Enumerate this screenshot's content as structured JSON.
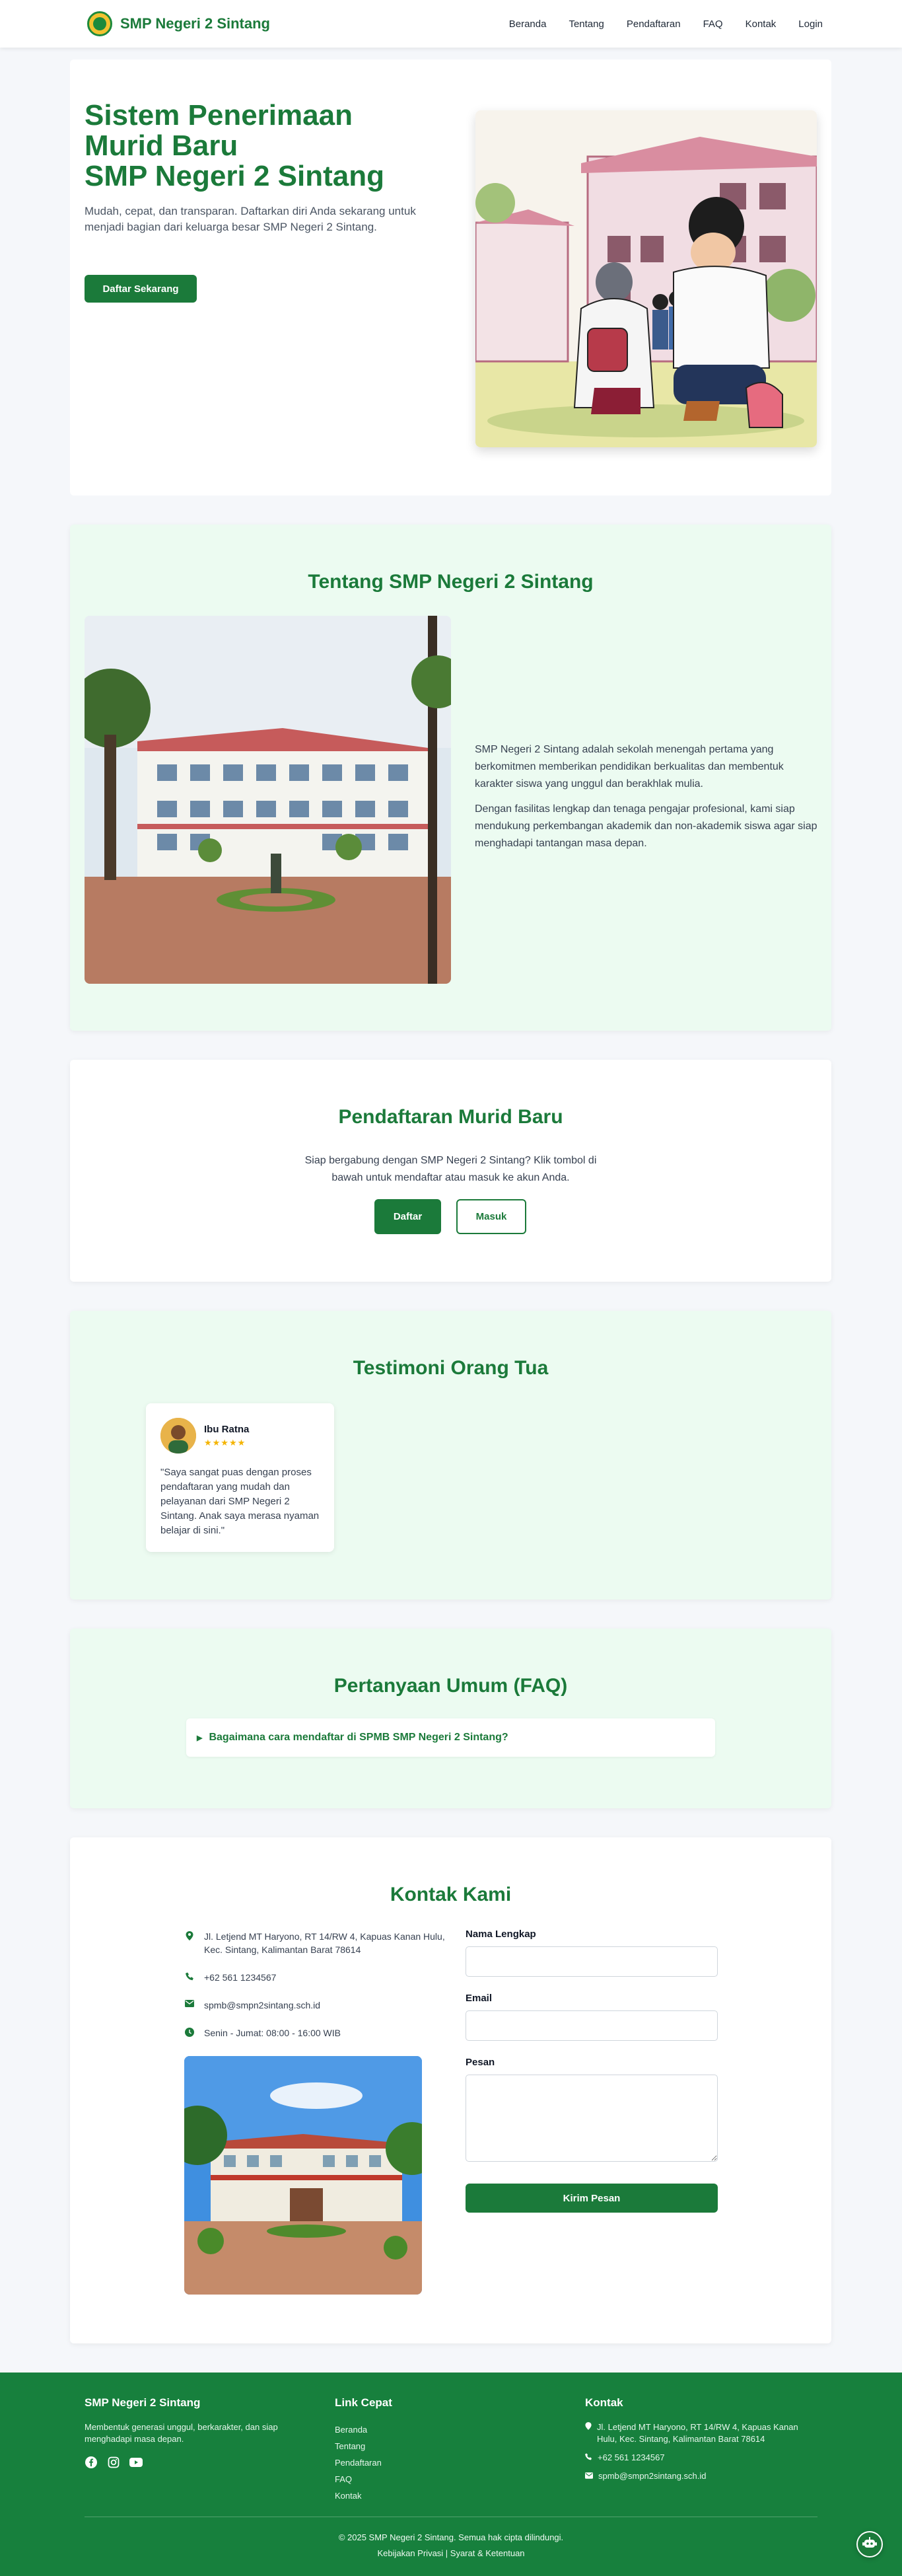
{
  "nav": {
    "brand": "SMP Negeri 2 Sintang",
    "menu": [
      "Beranda",
      "Tentang",
      "Pendaftaran",
      "FAQ",
      "Kontak",
      "Login"
    ]
  },
  "hero": {
    "title_line1": "Sistem Penerimaan",
    "title_line2": "Murid Baru",
    "title_line3": "SMP Negeri 2 Sintang",
    "description": "Mudah, cepat, dan transparan. Daftarkan diri Anda sekarang untuk menjadi bagian dari keluarga besar SMP Negeri 2 Sintang.",
    "cta": "Daftar Sekarang"
  },
  "about": {
    "title": "Tentang SMP Negeri 2 Sintang",
    "paragraph1": "SMP Negeri 2 Sintang adalah sekolah menengah pertama yang berkomitmen memberikan pendidikan berkualitas dan membentuk karakter siswa yang unggul dan berakhlak mulia.",
    "paragraph2": "Dengan fasilitas lengkap dan tenaga pengajar profesional, kami siap mendukung perkembangan akademik dan non-akademik siswa agar siap menghadapi tantangan masa depan."
  },
  "registration": {
    "title": "Pendaftaran Murid Baru",
    "description": "Siap bergabung dengan SMP Negeri 2 Sintang? Klik tombol di bawah untuk mendaftar atau masuk ke akun Anda.",
    "register_label": "Daftar",
    "login_label": "Masuk"
  },
  "testimonials": {
    "title": "Testimoni Orang Tua",
    "items": [
      {
        "name": "Ibu Ratna",
        "stars": "★★★★★",
        "quote": "\"Saya sangat puas dengan proses pendaftaran yang mudah dan pelayanan dari SMP Negeri 2 Sintang. Anak saya merasa nyaman belajar di sini.\""
      }
    ]
  },
  "faq": {
    "title": "Pertanyaan Umum (FAQ)",
    "items": [
      {
        "question": "Bagaimana cara mendaftar di SPMB SMP Negeri 2 Sintang?"
      }
    ]
  },
  "contact": {
    "title": "Kontak Kami",
    "address": "Jl. Letjend MT Haryono, RT 14/RW 4, Kapuas Kanan Hulu, Kec. Sintang, Kalimantan Barat 78614",
    "phone": "+62 561 1234567",
    "email": "spmb@smpn2sintang.sch.id",
    "hours": "Senin - Jumat: 08:00 - 16:00 WIB",
    "form": {
      "name_label": "Nama Lengkap",
      "email_label": "Email",
      "message_label": "Pesan",
      "submit_label": "Kirim Pesan"
    }
  },
  "footer": {
    "about_title": "SMP Negeri 2 Sintang",
    "about_text": "Membentuk generasi unggul, berkarakter, dan siap menghadapi masa depan.",
    "links_title": "Link Cepat",
    "links": [
      "Beranda",
      "Tentang",
      "Pendaftaran",
      "FAQ",
      "Kontak"
    ],
    "contact_title": "Kontak",
    "address": "Jl. Letjend MT Haryono, RT 14/RW 4, Kapuas Kanan Hulu, Kec. Sintang, Kalimantan Barat 78614",
    "phone": "+62 561 1234567",
    "email": "spmb@smpn2sintang.sch.id",
    "copyright": "© 2025 SMP Negeri 2 Sintang. Semua hak cipta dilindungi.",
    "policy": "Kebijakan Privasi | Syarat & Ketentuan"
  },
  "colors": {
    "primary": "#1b7a3a",
    "footer": "#17803d",
    "mint": "#ecfbf1",
    "star": "#f4b400"
  },
  "icons": [
    "school-logo-icon",
    "map-pin-icon",
    "phone-icon",
    "envelope-icon",
    "clock-icon",
    "facebook-icon",
    "instagram-icon",
    "youtube-icon",
    "chatbot-icon",
    "triangle-right-icon"
  ]
}
